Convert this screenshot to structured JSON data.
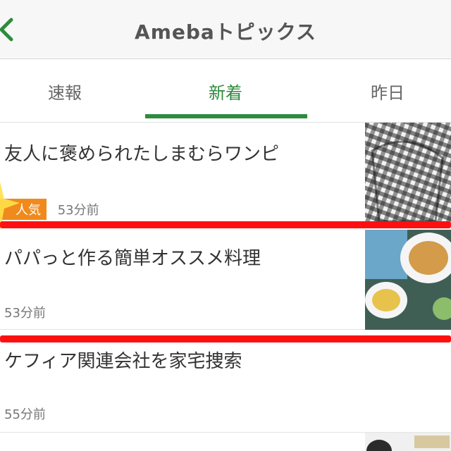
{
  "header": {
    "title": "Amebaトピックス",
    "back_icon": "chevron-left-icon"
  },
  "tabs": [
    {
      "label": "速報"
    },
    {
      "label": "新着",
      "active": true
    },
    {
      "label": "昨日"
    }
  ],
  "items": [
    {
      "title": "友人に褒められたしまむらワンピ",
      "badge": "人気",
      "time": "53分前"
    },
    {
      "title": "パパっと作る簡単オススメ料理",
      "time": "53分前"
    },
    {
      "title": "ケフィア関連会社を家宅捜索",
      "time": "55分前"
    }
  ],
  "colors": {
    "accent": "#2e8b3e",
    "badge": "#f08a1c",
    "highlight": "#ff1010"
  }
}
